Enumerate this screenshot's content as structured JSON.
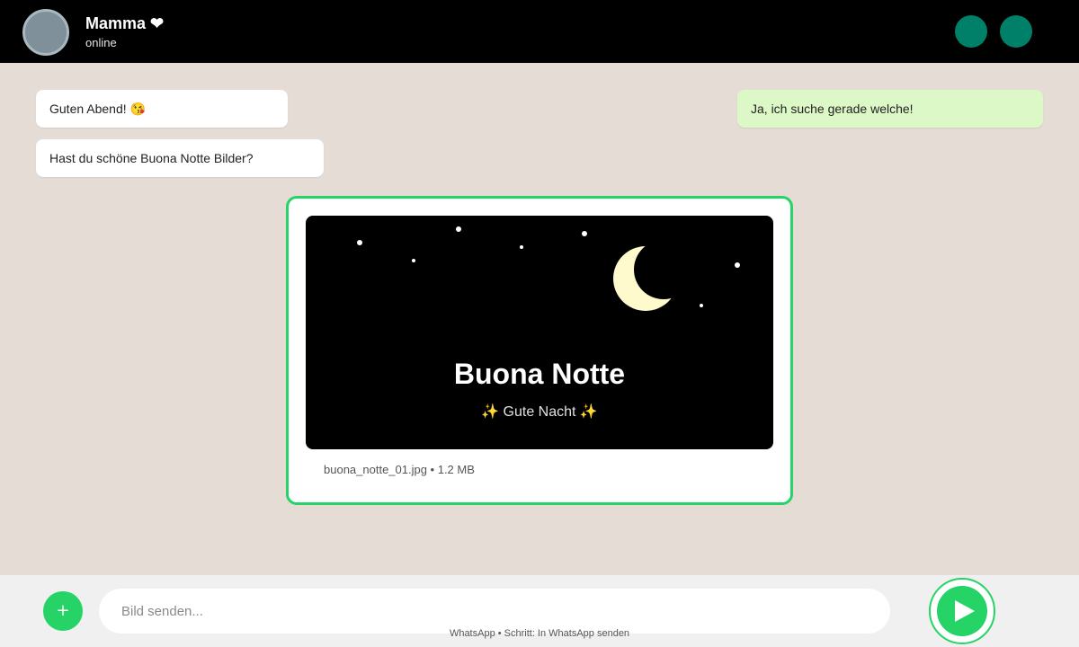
{
  "chat_header": {
    "contact_name": "Mamma ❤",
    "status": "online"
  },
  "messages": [
    {
      "direction": "incoming",
      "text": "Guten Abend! 😘"
    },
    {
      "direction": "incoming",
      "text": "Hast du schöne Buona Notte Bilder?"
    },
    {
      "direction": "outgoing",
      "text": "Ja, ich suche gerade welche!"
    }
  ],
  "image_card": {
    "title": "Buona Notte",
    "subtitle": "✨ Gute Nacht ✨",
    "file_info": "buona_notte_01.jpg • 1.2 MB",
    "icons": [
      "moon-icon",
      "star-icon"
    ]
  },
  "composer": {
    "attach_label": "+",
    "input_value": "",
    "input_placeholder": "Bild senden...",
    "send_icon": "send-icon"
  },
  "footer_hint": "WhatsApp • Schritt: In WhatsApp senden",
  "colors": {
    "header_bg": "#000000",
    "chat_bg": "#e5ddd5",
    "outgoing_bubble": "#dcf8c6",
    "accent_green": "#25d366",
    "header_button": "#008069",
    "moon": "#fffacd"
  }
}
